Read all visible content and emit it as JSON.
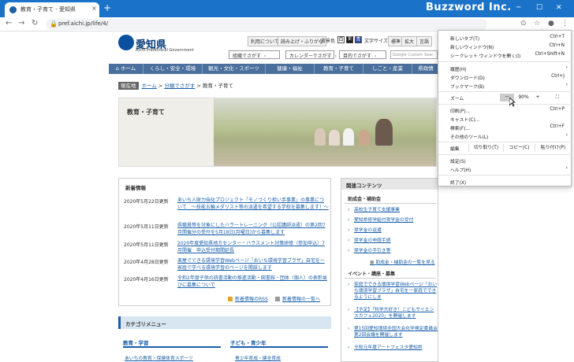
{
  "browser": {
    "tab_title": "教育・子育て - 愛知県",
    "tab_close": "×",
    "new_tab": "+",
    "brand": "Buzzword Inc.",
    "url": "pref.aichi.jp/life/4/",
    "accent": "#1a73c8"
  },
  "site": {
    "name": "愛知県",
    "name_en": "Aichi Prefectural Government",
    "util": {
      "sitemap": "利用について",
      "readout": "読み上げ・ふりがな",
      "bg_label": "背景色",
      "bg_white": "白",
      "bg_black": "黒",
      "bg_blue": "青",
      "fontsize_label": "文字サイズ",
      "normal": "標準",
      "large": "拡大",
      "english": "言語"
    },
    "search_buttons": [
      "組織でさがす",
      "カレンダーでさがす",
      "目的でさがす"
    ],
    "google_placeholder": "Google Custom Sear",
    "gnav": [
      "ホーム",
      "くらし・安全・環境",
      "観光・文化・スポーツ",
      "健康・福祉",
      "教育・子育て",
      "しごと・産業",
      "県政情"
    ],
    "breadcrumb": {
      "here": "現在地",
      "home": "ホーム",
      "sep1": " > ",
      "mid": "分類でさがす",
      "sep2": " > ",
      "current": "教育・子育て"
    },
    "hero_title": "教育・子育て"
  },
  "news": {
    "heading": "新着情報",
    "items": [
      {
        "date": "2020年5月22日更新",
        "text": "あいち人財力強化プロジェクト「モノづくり担い手事業」の事業について　～技能五輪メダリスト等の派遣を希望する学校を募集します！～"
      },
      {
        "date": "2020年5月11日更新",
        "text": "県職員等を対象にしたハラートレーニング（公認講師派遣）の第2回7月開催分の受付を5月18日(月曜日)から募集します"
      },
      {
        "date": "2020年5月11日更新",
        "text": "2020年度愛知県地方センター・ハラスメント対策研修（参加申込）7月開催　申込受付期間延長"
      },
      {
        "date": "2020年4月28日更新",
        "text": "楽屋でできる環境学習Webページ「おいち環境学習プラザ」自宅を一家庭で学べる環境学習のページを開設します"
      },
      {
        "date": "2020年4月16日更新",
        "text": "令和2年度子供の読書活動の推進活動・図書館・団体（個人）の表彰並びに募集について"
      }
    ],
    "rss": "新着情報のRSS",
    "list": "新着情報の一覧へ"
  },
  "related": {
    "heading": "関連コンテンツ",
    "sub1": "助成金・補助金",
    "links1": [
      "高校生子育て支援事業",
      "愛知県修学給付奨学金の受付",
      "奨学金の返還",
      "奨学金の申請手続",
      "奨学金の手引き等"
    ],
    "more1": "助成金・補助金の一覧を見る",
    "sub2": "イベント・講座・募集",
    "links2": [
      "家庭でできる環境学習Webページ「おいち環境学習プラザ」自宅を一家庭でできるようにしま",
      "【予定】「科学大好き！こどもサイエンスカフェ2020」を開催します",
      "第15回愛知環境全国大会化学検定委員会第2回会議を開催します",
      "令和元年度アートフェスタ愛知県"
    ]
  },
  "categories": {
    "heading": "カテゴリメニュー",
    "col1": "教育・学習",
    "col2": "子ども・青少年",
    "col1_link": "あいちの教育・保健体育スポーツ",
    "col2_link": "青少年育成・健全育成"
  },
  "menu": {
    "new_tab": "新しいタブ(T)",
    "new_tab_key": "Ctrl+T",
    "new_window": "新しいウィンドウ(N)",
    "new_window_key": "Ctrl+N",
    "incognito": "シークレット ウィンドウを開く(I)",
    "incognito_key": "Ctrl+Shift+N",
    "history": "履歴(H)",
    "downloads": "ダウンロード(D)",
    "downloads_key": "Ctrl+J",
    "bookmarks": "ブックマーク(B)",
    "zoom": "ズーム",
    "zoom_minus": "－",
    "zoom_value": "90%",
    "zoom_plus": "+",
    "fullscreen": "⛶",
    "print": "印刷(P)...",
    "print_key": "Ctrl+P",
    "cast": "キャスト(C)...",
    "find": "検索(F)...",
    "find_key": "Ctrl+F",
    "more_tools": "その他のツール(L)",
    "edit": "編集",
    "cut": "切り取り(T)",
    "copy": "コピー(C)",
    "paste": "貼り付け(P)",
    "settings": "設定(S)",
    "help": "ヘルプ(H)",
    "exit": "終了(X)"
  }
}
